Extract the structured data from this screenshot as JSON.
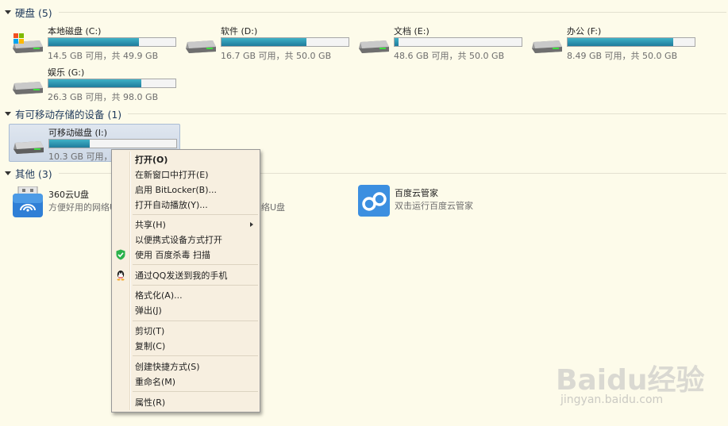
{
  "groups": {
    "hdd": "硬盘 (5)",
    "removable": "有可移动存储的设备 (1)",
    "other": "其他 (3)"
  },
  "drives": [
    {
      "name": "本地磁盘 (C:)",
      "info": "14.5 GB 可用，共 49.9 GB",
      "used": 0.71
    },
    {
      "name": "软件 (D:)",
      "info": "16.7 GB 可用，共 50.0 GB",
      "used": 0.67
    },
    {
      "name": "文档 (E:)",
      "info": "48.6 GB 可用，共 50.0 GB",
      "used": 0.03
    },
    {
      "name": "办公 (F:)",
      "info": "8.49 GB 可用，共 50.0 GB",
      "used": 0.83
    },
    {
      "name": "娱乐 (G:)",
      "info": "26.3 GB 可用，共 98.0 GB",
      "used": 0.73
    }
  ],
  "removable_drive": {
    "name": "可移动磁盘 (I:)",
    "info": "10.3 GB 可用，共",
    "used": 0.32
  },
  "apps": [
    {
      "name": "360云U盘",
      "desc": "方便好用的网络U"
    },
    {
      "name": "",
      "desc": "网络U盘"
    },
    {
      "name": "百度云管家",
      "desc": "双击运行百度云管家"
    }
  ],
  "menu": {
    "open": "打开(O)",
    "open_new_window": "在新窗口中打开(E)",
    "bitlocker": "启用 BitLocker(B)...",
    "autoplay": "打开自动播放(Y)...",
    "share": "共享(H)",
    "portable": "以便携式设备方式打开",
    "scan": "使用 百度杀毒 扫描",
    "qq_send": "通过QQ发送到我的手机",
    "format": "格式化(A)...",
    "eject": "弹出(J)",
    "cut": "剪切(T)",
    "copy": "复制(C)",
    "shortcut": "创建快捷方式(S)",
    "rename": "重命名(M)",
    "properties": "属性(R)"
  },
  "watermark": {
    "big": "Baidu经验",
    "small": "jingyan.baidu.com"
  },
  "colors": {
    "background": "#fdfbea",
    "bar_fill": "#2a93b0",
    "group_title": "#1e395b"
  }
}
